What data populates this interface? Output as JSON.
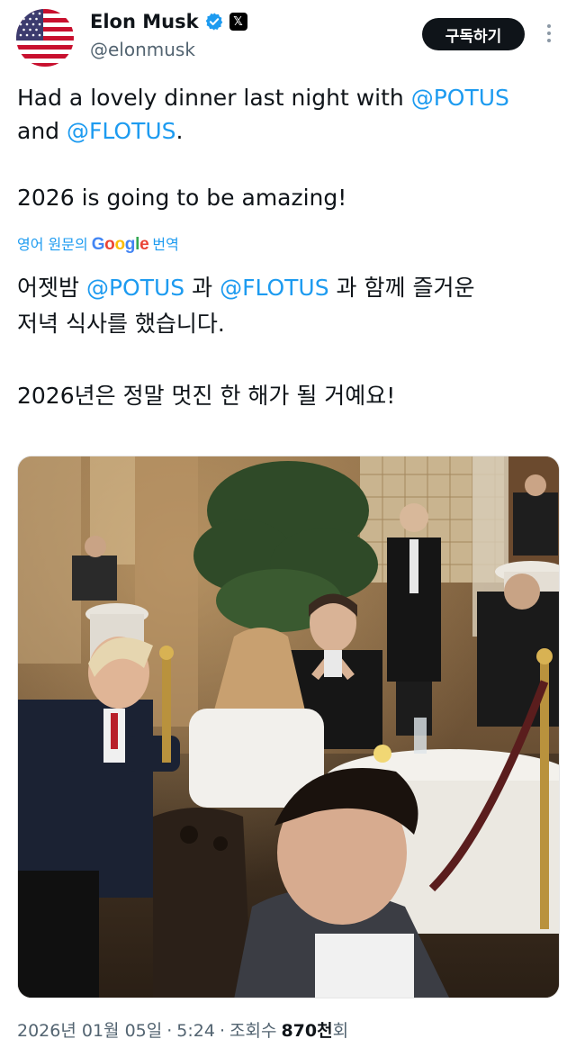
{
  "author": {
    "name": "Elon Musk",
    "handle": "@elonmusk",
    "avatar": "us-flag-avatar",
    "verified_icon": "verified-badge-icon",
    "affiliate_icon": "x-logo-icon",
    "affiliate_glyph": "𝕏"
  },
  "header": {
    "subscribe_label": "구독하기",
    "more_icon": "more-vertical-icon"
  },
  "tweet": {
    "line1_text": "Had a lovely dinner last night with ",
    "mention_potus": "@POTUS",
    "line2_text": "and ",
    "mention_flotus": "@FLOTUS",
    "line2_end": ".",
    "line3": "2026 is going to be amazing!"
  },
  "translation": {
    "prefix": "영어 원문의",
    "brand": "Google",
    "suffix": "번역",
    "part1": "어젯밤 ",
    "mention_potus": "@POTUS",
    "part2": " 과 ",
    "mention_flotus": "@FLOTUS",
    "part3": " 과 함께 즐거운",
    "line2": "저녁 식사를 했습니다.",
    "line3": "2026년은 정말 멋진 한 해가 될 거예요!"
  },
  "media": {
    "kind": "photo",
    "subject": "dinner-restaurant-photo"
  },
  "meta": {
    "date": "2026년 01월 05일",
    "sep1": "·",
    "time": "5:24",
    "sep2": "·",
    "views_label": "조회수",
    "views_count": "870천",
    "views_suffix": "회"
  },
  "colors": {
    "accent": "#1d9bf0",
    "text": "#0f1419",
    "secondary": "#536471",
    "button_bg": "#0f1419"
  }
}
